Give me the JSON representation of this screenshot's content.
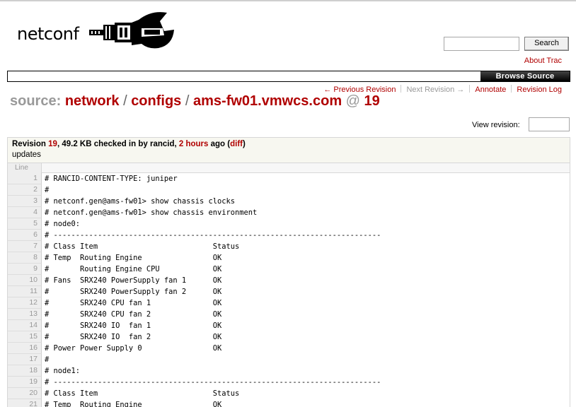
{
  "header": {
    "logo_text": "netconf",
    "search": {
      "placeholder": "",
      "button_label": "Search"
    },
    "about_link": "About Trac"
  },
  "mainnav": {
    "active_tab": "Browse Source"
  },
  "ctxnav": {
    "previous": "← Previous Revision",
    "next": "Next Revision →",
    "annotate": "Annotate",
    "revision_log": "Revision Log"
  },
  "path": {
    "prefix": "source:",
    "segments": [
      "network",
      "configs",
      "ams-fw01.vmwcs.com"
    ],
    "at": "@",
    "revision": "19"
  },
  "view_revision": {
    "label": "View revision:",
    "value": ""
  },
  "info": {
    "revision_label": "Revision",
    "revision": "19",
    "size_text": ", 49.2 KB checked in by rancid, ",
    "age": "2 hours",
    "age_suffix": " ago (",
    "diff": "diff",
    "close": ")",
    "message": "updates"
  },
  "listing": {
    "line_header": "Line",
    "lines": [
      {
        "n": "1",
        "text": "# RANCID-CONTENT-TYPE: juniper"
      },
      {
        "n": "2",
        "text": "#"
      },
      {
        "n": "3",
        "text": "# netconf.gen@ams-fw01> show chassis clocks"
      },
      {
        "n": "4",
        "text": "# netconf.gen@ams-fw01> show chassis environment"
      },
      {
        "n": "5",
        "text": "# node0:"
      },
      {
        "n": "6",
        "text": "# --------------------------------------------------------------------------"
      },
      {
        "n": "7",
        "text": "# Class Item                          Status"
      },
      {
        "n": "8",
        "text": "# Temp  Routing Engine                OK"
      },
      {
        "n": "9",
        "text": "#       Routing Engine CPU            OK"
      },
      {
        "n": "10",
        "text": "# Fans  SRX240 PowerSupply fan 1      OK"
      },
      {
        "n": "11",
        "text": "#       SRX240 PowerSupply fan 2      OK"
      },
      {
        "n": "12",
        "text": "#       SRX240 CPU fan 1              OK"
      },
      {
        "n": "13",
        "text": "#       SRX240 CPU fan 2              OK"
      },
      {
        "n": "14",
        "text": "#       SRX240 IO  fan 1              OK"
      },
      {
        "n": "15",
        "text": "#       SRX240 IO  fan 2              OK"
      },
      {
        "n": "16",
        "text": "# Power Power Supply 0                OK"
      },
      {
        "n": "17",
        "text": "#"
      },
      {
        "n": "18",
        "text": "# node1:"
      },
      {
        "n": "19",
        "text": "# --------------------------------------------------------------------------"
      },
      {
        "n": "20",
        "text": "# Class Item                          Status"
      },
      {
        "n": "21",
        "text": "# Temp  Routing Engine                OK"
      }
    ]
  }
}
